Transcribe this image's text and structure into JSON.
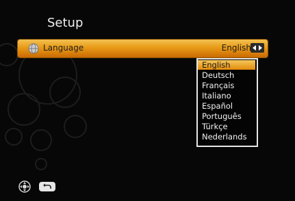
{
  "screen": {
    "title": "Setup"
  },
  "language_row": {
    "label": "Language",
    "value": "English",
    "icon": "globe-icon",
    "control_icon": "left-right-arrows-icon"
  },
  "dropdown": {
    "options": [
      "English",
      "Deutsch",
      "Français",
      "Italiano",
      "Español",
      "Português",
      "Türkçe",
      "Nederlands"
    ],
    "selected": "English"
  },
  "footer": {
    "icons": [
      "navigation-pad-icon",
      "back-icon"
    ]
  },
  "colors": {
    "highlight": "#e89a16",
    "background": "#070707",
    "text": "#f2f2f2"
  }
}
